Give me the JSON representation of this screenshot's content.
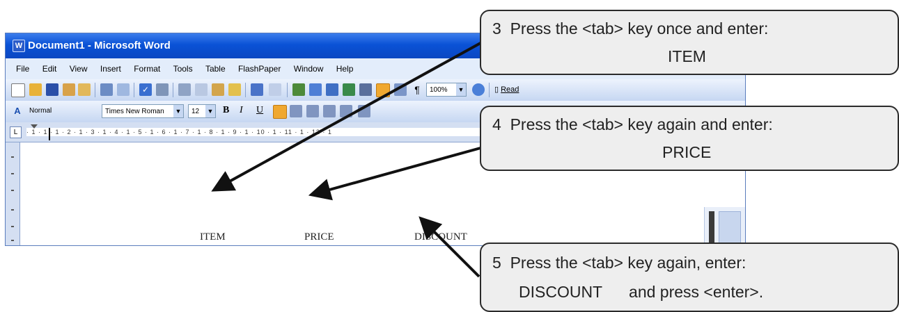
{
  "window": {
    "title": "Document1 - Microsoft Word",
    "app_icon": "W"
  },
  "menu": [
    "File",
    "Edit",
    "View",
    "Insert",
    "Format",
    "Tools",
    "Table",
    "FlashPaper",
    "Window",
    "Help"
  ],
  "toolbar1": {
    "zoom": "100%",
    "read_label": "Read"
  },
  "toolbar2": {
    "style": "Normal",
    "font": "Times New Roman",
    "size": "12",
    "bold": "B",
    "italic": "I",
    "underline": "U"
  },
  "ruler": {
    "marks": "· 1 · 1 · 1 · 2 · 1 · 3 · 1 · 4 · 1 · 5 · 1 · 6 · 1 · 7 · 1 · 8 · 1 · 9 · 1 · 10 · 1 · 11 · 1 · 12 · 1"
  },
  "document": {
    "line1": [
      "ITEM",
      "PRICE",
      "DISCOUNT"
    ]
  },
  "callouts": [
    {
      "lines": [
        "3  Press the <tab> key once and enter:",
        "ITEM"
      ]
    },
    {
      "lines": [
        "4  Press the <tab> key again and enter:",
        "PRICE"
      ]
    },
    {
      "lines": [
        "5  Press the <tab> key again, enter:",
        "DISCOUNT      and press <enter>."
      ]
    }
  ],
  "colors": {
    "titlebar": "#0a52d6",
    "callout_bg": "#eeeeee",
    "arrow": "#111111"
  },
  "icons": [
    "new-document-icon",
    "open-folder-icon",
    "save-icon",
    "permission-icon",
    "email-icon",
    "print-icon",
    "print-preview-icon",
    "spelling-icon",
    "research-icon",
    "cut-icon",
    "copy-icon",
    "paste-icon",
    "format-painter-icon",
    "undo-icon",
    "redo-icon",
    "hyperlink-icon",
    "tables-borders-icon",
    "insert-table-icon",
    "insert-excel-icon",
    "columns-icon",
    "drawing-icon",
    "document-map-icon",
    "show-hide-icon",
    "help-icon",
    "styles-icon",
    "align-left-icon",
    "center-icon",
    "align-right-icon",
    "justify-icon",
    "line-spacing-icon",
    "numbering-icon"
  ]
}
